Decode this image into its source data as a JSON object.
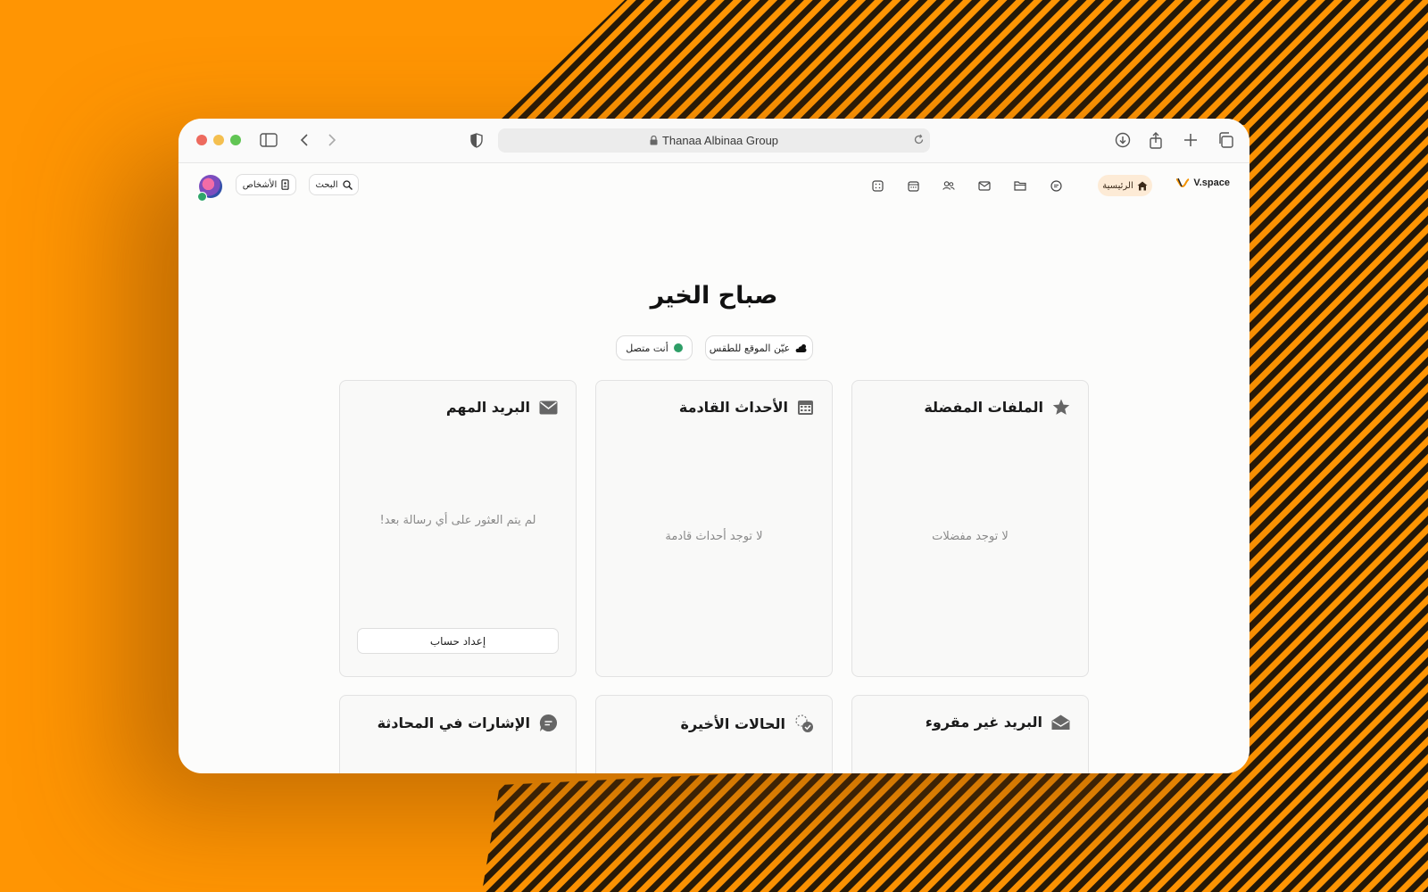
{
  "browser": {
    "url_text": "Thanaa Albinaa Group"
  },
  "app": {
    "logo_text": "V.space",
    "nav": {
      "home_label": "الرئيسية",
      "icons": [
        "chat-icon",
        "folder-icon",
        "mail-icon",
        "people-icon",
        "calendar-icon",
        "grid-icon"
      ]
    },
    "search_label": "البحث",
    "people_label": "الأشخاص"
  },
  "main": {
    "greeting": "صباح الخير",
    "weather_chip": "عيّن الموقع للطقس",
    "status_chip": "أنت متصل",
    "cards": {
      "favorites": {
        "title": "الملفات المفضلة",
        "empty": "لا توجد مفضلات",
        "icon": "star-icon"
      },
      "events": {
        "title": "الأحداث القادمة",
        "empty": "لا توجد أحداث قادمة",
        "icon": "calendar-icon"
      },
      "important_mail": {
        "title": "البريد المهم",
        "empty": "لم يتم العثور على أي رسالة بعد!",
        "button": "إعداد حساب",
        "icon": "envelope-icon"
      },
      "unread_mail": {
        "title": "البريد غير مقروء",
        "icon": "open-envelope-icon"
      },
      "recent_status": {
        "title": "الحالات الأخيرة",
        "icon": "status-check-icon"
      },
      "mentions": {
        "title": "الإشارات في المحادثة",
        "icon": "chat-bubble-icon"
      }
    }
  },
  "colors": {
    "background": "#ff9503",
    "pattern": "#1a1208",
    "accent_light": "#fdebd6",
    "online": "#2e9e67"
  }
}
